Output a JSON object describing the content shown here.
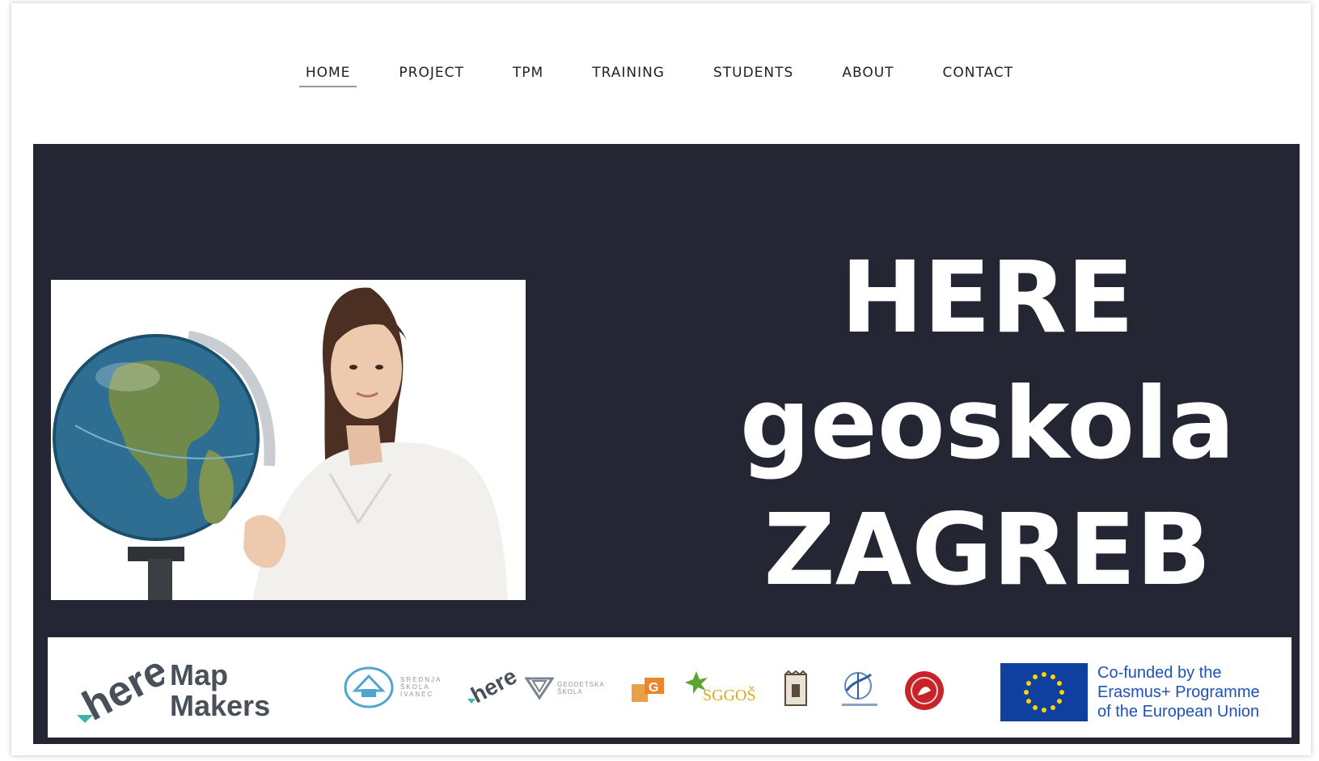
{
  "nav": {
    "items": [
      {
        "label": "HOME",
        "active": true
      },
      {
        "label": "PROJECT",
        "active": false
      },
      {
        "label": "TPM",
        "active": false
      },
      {
        "label": "TRAINING",
        "active": false
      },
      {
        "label": "STUDENTS",
        "active": false
      },
      {
        "label": "ABOUT",
        "active": false
      },
      {
        "label": "CONTACT",
        "active": false
      }
    ]
  },
  "hero": {
    "line1": "HERE",
    "line2": "geoskola",
    "line3": "ZAGREB",
    "background": "#242733"
  },
  "logos": {
    "here_word": "here",
    "map_makers_line1": "Map",
    "map_makers_line2": "Makers",
    "school_ivanec": [
      "SREDNJA",
      "ŠKOLA",
      "IVANEC"
    ],
    "geodetska": [
      "GEODETSKA",
      "ŠKOLA"
    ],
    "sggos": "SGGOŠ",
    "eu_text": [
      "Co-funded by the",
      "Erasmus+ Programme",
      "of the European Union"
    ],
    "eu_blue": "#0f3f9f",
    "teal": "#39b5ad"
  }
}
